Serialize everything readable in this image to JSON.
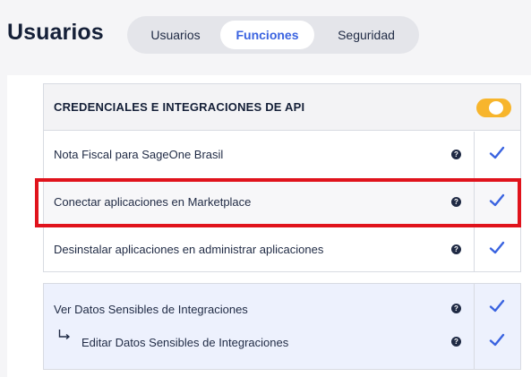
{
  "header": {
    "title": "Usuarios",
    "tabs": [
      {
        "label": "Usuarios",
        "active": false
      },
      {
        "label": "Funciones",
        "active": true
      },
      {
        "label": "Seguridad",
        "active": false
      }
    ]
  },
  "section": {
    "title": "CREDENCIALES E INTEGRACIONES DE API",
    "toggle_on": true,
    "rows": [
      {
        "label": "Nota Fiscal para SageOne Brasil",
        "checked": true
      },
      {
        "label": "Conectar aplicaciones en Marketplace",
        "checked": true,
        "highlighted": true
      },
      {
        "label": "Desinstalar aplicaciones en administrar aplicaciones",
        "checked": true
      }
    ]
  },
  "sensitive": {
    "rows": [
      {
        "label": "Ver Datos Sensibles de Integraciones",
        "checked": true
      },
      {
        "label": "Editar Datos Sensibles de Integraciones",
        "checked": true
      }
    ]
  },
  "help_glyph": "?",
  "colors": {
    "accent": "#3a63e0",
    "toggle": "#f7b52c",
    "highlight": "#e0131c",
    "check": "#3a63e0"
  }
}
